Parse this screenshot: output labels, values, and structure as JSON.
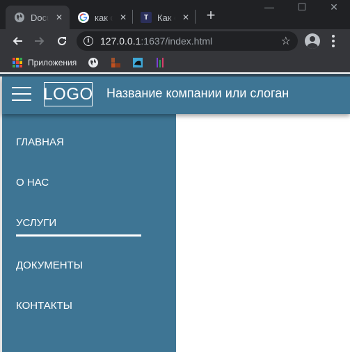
{
  "browser": {
    "tabs": [
      {
        "title": "Document",
        "icon": "globe-icon",
        "active": true
      },
      {
        "title": "как сделать",
        "icon": "google-icon",
        "active": false
      },
      {
        "title": "Как сделать",
        "icon": "tproger-icon",
        "active": false
      }
    ],
    "close_glyph": "✕",
    "new_tab_glyph": "+",
    "window_controls": {
      "minimize": "—",
      "maximize": "☐",
      "close": "✕"
    },
    "address": {
      "host": "127.0.0.1",
      "rest": ":1637/index.html"
    },
    "info_glyph": "i",
    "star_glyph": "☆",
    "bookmarks": {
      "apps_label": "Приложения",
      "items": [
        "globe-bookmark-icon",
        "blocks-bookmark-icon",
        "photo-bookmark-icon",
        "bars-bookmark-icon"
      ]
    }
  },
  "site": {
    "logo": "LOGO",
    "slogan": "Название компании или слоган",
    "nav": [
      {
        "label": "ГЛАВНАЯ",
        "active": false
      },
      {
        "label": "О НАС",
        "active": false
      },
      {
        "label": "УСЛУГИ",
        "active": true
      },
      {
        "label": "ДОКУМЕНТЫ",
        "active": false
      },
      {
        "label": "КОНТАКТЫ",
        "active": false
      }
    ]
  },
  "colors": {
    "header": "#3e7594",
    "sidebar": "#3e7594",
    "chrome_dark": "#202124",
    "chrome_toolbar": "#35363a",
    "text_light": "#ffffff"
  }
}
